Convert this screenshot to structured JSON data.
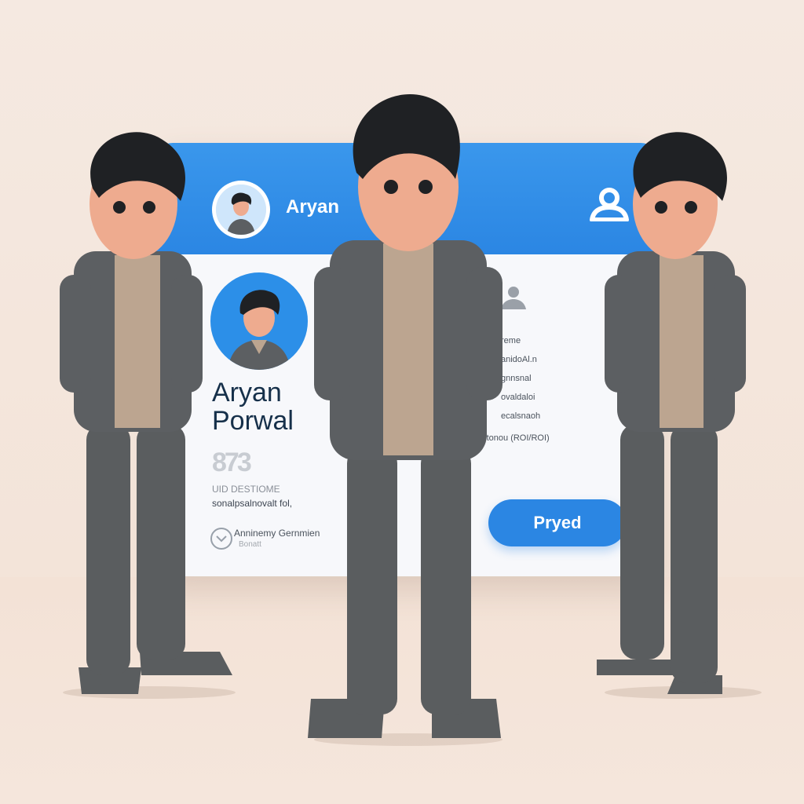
{
  "card": {
    "header_name": "Aryan",
    "profile_name_line1": "Aryan",
    "profile_name_line2": "Porwal",
    "stat_number": "873",
    "info_line_1": "UID DESTIOME",
    "info_line_2": "sonalpsalnovalt fol,",
    "badge_text": "Anninemy Gernmien",
    "badge_sub": "Bonatt",
    "field_1": "reme",
    "field_2": "anidoAl.n",
    "field_3": "gnnsnal",
    "field_4": "ovaldaloi",
    "field_5": "ecalsnaoh",
    "field_6": "(sltonou (ROI/ROI)",
    "button_label": "Pryed"
  },
  "colors": {
    "accent_blue": "#2b86e3",
    "background": "#f5e9e1",
    "jacket": "#5c5f62",
    "pants": "#5a5d5f",
    "shirt": "#bca590",
    "skin": "#eeab8f",
    "hair": "#1f2124"
  },
  "icons": {
    "header_right": "user-icon",
    "side": "user-icon",
    "badge": "chevron-badge-icon"
  }
}
